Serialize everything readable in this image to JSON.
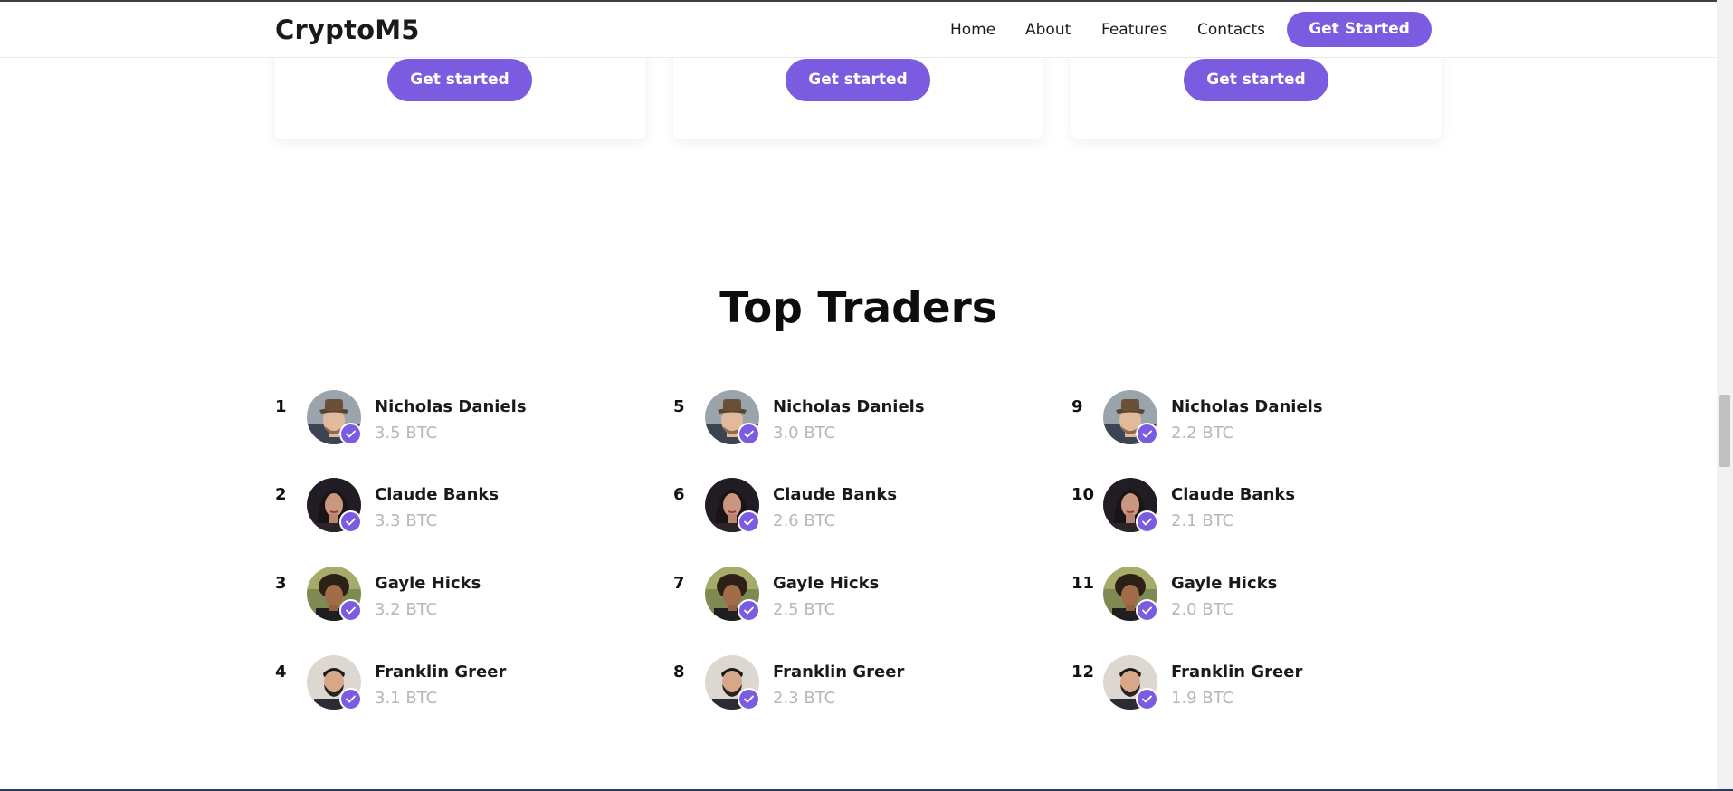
{
  "header": {
    "logo": "CryptoM5",
    "nav": [
      {
        "label": "Home"
      },
      {
        "label": "About"
      },
      {
        "label": "Features"
      },
      {
        "label": "Contacts"
      }
    ],
    "cta_label": "Get Started"
  },
  "plans": [
    {
      "button_label": "Get started"
    },
    {
      "button_label": "Get started"
    },
    {
      "button_label": "Get started"
    }
  ],
  "top_traders": {
    "title": "Top Traders",
    "columns": [
      [
        {
          "rank": "1",
          "name": "Nicholas Daniels",
          "value": "3.5 BTC",
          "avatar": "avatar-hat-man"
        },
        {
          "rank": "2",
          "name": "Claude Banks",
          "value": "3.3 BTC",
          "avatar": "avatar-woman-dark-hair"
        },
        {
          "rank": "3",
          "name": "Gayle Hicks",
          "value": "3.2 BTC",
          "avatar": "avatar-curly-hair"
        },
        {
          "rank": "4",
          "name": "Franklin Greer",
          "value": "3.1 BTC",
          "avatar": "avatar-bearded-man"
        }
      ],
      [
        {
          "rank": "5",
          "name": "Nicholas Daniels",
          "value": "3.0 BTC",
          "avatar": "avatar-hat-man"
        },
        {
          "rank": "6",
          "name": "Claude Banks",
          "value": "2.6 BTC",
          "avatar": "avatar-woman-dark-hair"
        },
        {
          "rank": "7",
          "name": "Gayle Hicks",
          "value": "2.5 BTC",
          "avatar": "avatar-curly-hair"
        },
        {
          "rank": "8",
          "name": "Franklin Greer",
          "value": "2.3 BTC",
          "avatar": "avatar-bearded-man"
        }
      ],
      [
        {
          "rank": "9",
          "name": "Nicholas Daniels",
          "value": "2.2 BTC",
          "avatar": "avatar-hat-man"
        },
        {
          "rank": "10",
          "name": "Claude Banks",
          "value": "2.1 BTC",
          "avatar": "avatar-woman-dark-hair"
        },
        {
          "rank": "11",
          "name": "Gayle Hicks",
          "value": "2.0 BTC",
          "avatar": "avatar-curly-hair"
        },
        {
          "rank": "12",
          "name": "Franklin Greer",
          "value": "1.9 BTC",
          "avatar": "avatar-bearded-man"
        }
      ]
    ],
    "badge_icon": "check-badge-icon"
  },
  "colors": {
    "accent": "#7b5ce1",
    "muted_text": "#b6b6bc"
  }
}
